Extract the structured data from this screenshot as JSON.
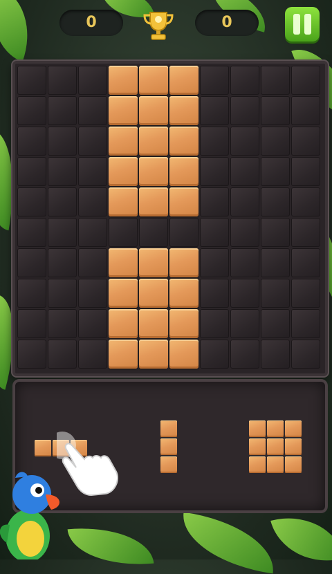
{
  "score": {
    "current": "0",
    "best": "0"
  },
  "board": {
    "size": 10,
    "filled": [
      [
        0,
        3
      ],
      [
        0,
        4
      ],
      [
        0,
        5
      ],
      [
        1,
        3
      ],
      [
        1,
        4
      ],
      [
        1,
        5
      ],
      [
        2,
        3
      ],
      [
        2,
        4
      ],
      [
        2,
        5
      ],
      [
        3,
        3
      ],
      [
        3,
        4
      ],
      [
        3,
        5
      ],
      [
        4,
        3
      ],
      [
        4,
        4
      ],
      [
        4,
        5
      ],
      [
        6,
        3
      ],
      [
        6,
        4
      ],
      [
        6,
        5
      ],
      [
        7,
        3
      ],
      [
        7,
        4
      ],
      [
        7,
        5
      ],
      [
        8,
        3
      ],
      [
        8,
        4
      ],
      [
        8,
        5
      ],
      [
        9,
        3
      ],
      [
        9,
        4
      ],
      [
        9,
        5
      ]
    ]
  },
  "tray": {
    "pieces": [
      {
        "name": "horizontal-3-piece",
        "rows": 1,
        "cols": 3
      },
      {
        "name": "vertical-3-piece",
        "rows": 3,
        "cols": 1
      },
      {
        "name": "square-3x3-piece",
        "rows": 3,
        "cols": 3
      }
    ]
  },
  "colors": {
    "wood": "#e4995a",
    "cell": "#2c2629",
    "accent_green": "#6cc42b",
    "gold": "#e8c65a"
  },
  "icons": [
    "trophy-icon",
    "pause-icon",
    "tutorial-hand-icon",
    "parrot-mascot"
  ]
}
